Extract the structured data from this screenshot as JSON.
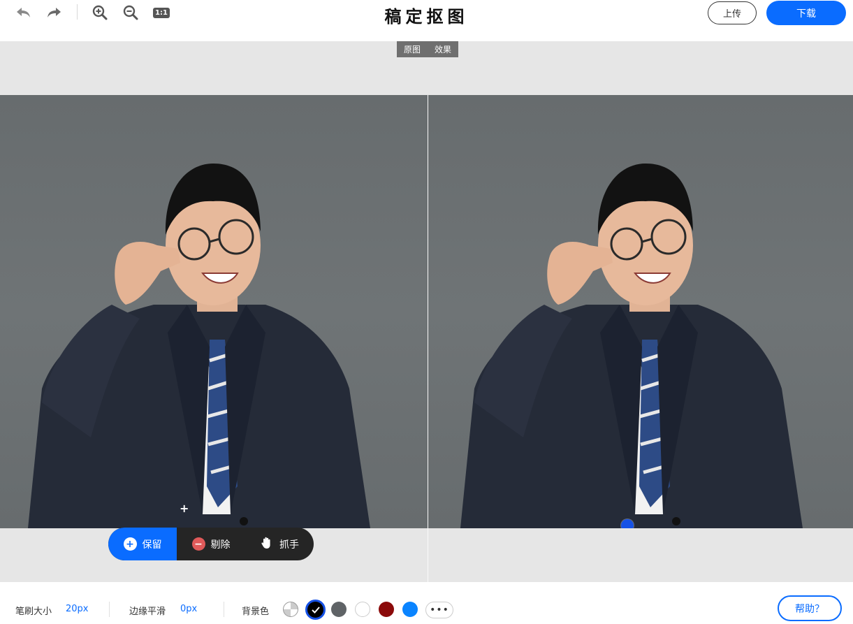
{
  "app": {
    "title": "稿定抠图"
  },
  "toolbar": {
    "undo_icon": "undo-icon",
    "redo_icon": "redo-icon",
    "zoom_in_icon": "zoom-in-icon",
    "zoom_out_icon": "zoom-out-icon",
    "actual_size_label": "1:1",
    "upload_label": "上传",
    "download_label": "下载"
  },
  "view_toggle": {
    "original_label": "原图",
    "result_label": "效果"
  },
  "brush_modes": {
    "keep_label": "保留",
    "erase_label": "剔除",
    "grab_label": "抓手",
    "active": "keep"
  },
  "settings": {
    "brush_size_label": "笔刷大小",
    "brush_size_value": "20px",
    "edge_smooth_label": "边缘平滑",
    "edge_smooth_value": "0px",
    "bg_color_label": "背景色",
    "bg_colors": [
      "transparent",
      "#000000",
      "#5f6366",
      "#ffffff",
      "#8b0a0a",
      "#0a84ff"
    ],
    "selected_bg_color": "#000000",
    "more_label": "•••",
    "help_label": "帮助？"
  },
  "colors": {
    "accent": "#0a6cff",
    "modebar": "#252525",
    "canvas_bg": "#e6e6e6"
  }
}
